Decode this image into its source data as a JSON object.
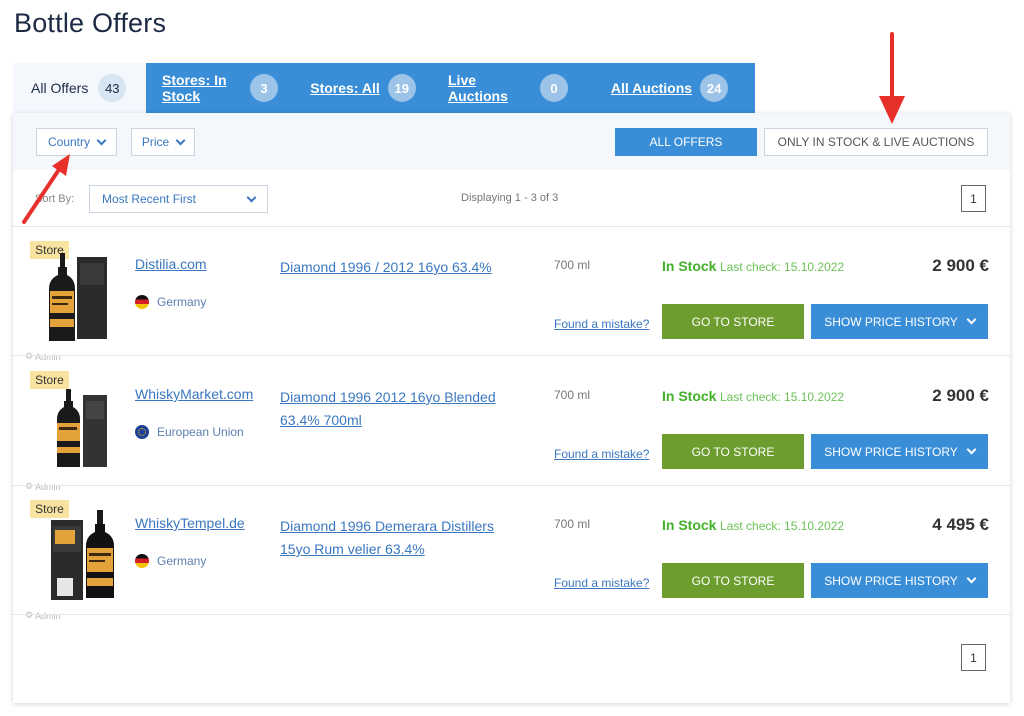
{
  "page_title": "Bottle Offers",
  "tabs": [
    {
      "label": "All Offers",
      "count": "43"
    },
    {
      "label": "Stores: In Stock",
      "count": "3"
    },
    {
      "label": "Stores: All",
      "count": "19"
    },
    {
      "label": "Live Auctions",
      "count": "0"
    },
    {
      "label": "All Auctions",
      "count": "24"
    }
  ],
  "filters": {
    "country": "Country",
    "price": "Price",
    "all_offers": "ALL OFFERS",
    "in_stock_live": "ONLY IN STOCK & LIVE AUCTIONS"
  },
  "sort": {
    "label": "Sort By:",
    "value": "Most Recent First"
  },
  "displaying": "Displaying 1 - 3 of 3",
  "pagination": {
    "page": "1"
  },
  "offers": [
    {
      "badge": "Store",
      "store": "Distilia.com",
      "country": "Germany",
      "flag": "germany-flag-icon",
      "name": "Diamond 1996 / 2012 16yo 63.4%",
      "volume": "700 ml",
      "mistake": "Found a mistake?",
      "stock": "In Stock",
      "last_check": "Last check: 15.10.2022",
      "price": "2 900 €",
      "go": "GO TO STORE",
      "history": "SHOW PRICE HISTORY",
      "admin": "Admin"
    },
    {
      "badge": "Store",
      "store": "WhiskyMarket.com",
      "country": "European Union",
      "flag": "eu-flag-icon",
      "name": "Diamond 1996 2012 16yo Blended 63.4% 700ml",
      "volume": "700 ml",
      "mistake": "Found a mistake?",
      "stock": "In Stock",
      "last_check": "Last check: 15.10.2022",
      "price": "2 900 €",
      "go": "GO TO STORE",
      "history": "SHOW PRICE HISTORY",
      "admin": "Admin"
    },
    {
      "badge": "Store",
      "store": "WhiskyTempel.de",
      "country": "Germany",
      "flag": "germany-flag-icon",
      "name": "Diamond 1996 Demerara Distillers 15yo Rum velier 63.4%",
      "volume": "700 ml",
      "mistake": "Found a mistake?",
      "stock": "In Stock",
      "last_check": "Last check: 15.10.2022",
      "price": "4 495 €",
      "go": "GO TO STORE",
      "history": "SHOW PRICE HISTORY",
      "admin": "Admin"
    }
  ],
  "colors": {
    "accent": "#3a8ed7",
    "go_button": "#6d9d2e",
    "in_stock": "#43b02a",
    "badge": "#f9e3a1",
    "annotation_arrow": "#e8302b"
  }
}
